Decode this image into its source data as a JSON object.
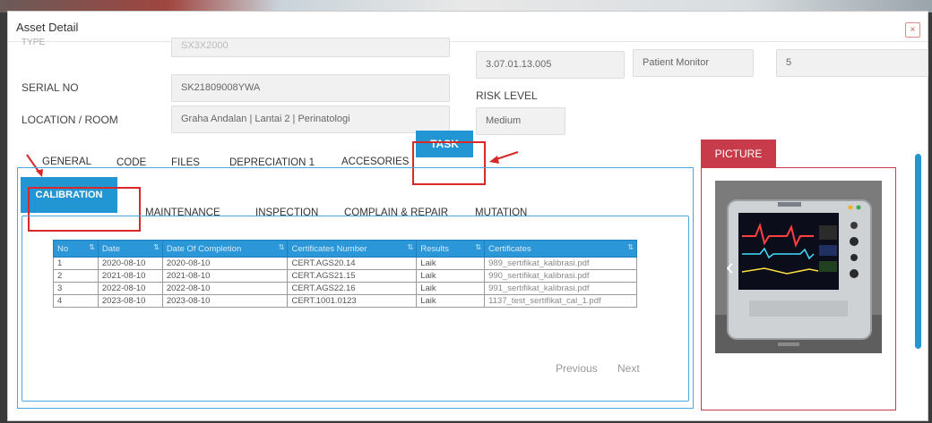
{
  "modal": {
    "title": "Asset Detail",
    "close_label": "×"
  },
  "form": {
    "type_label": "TYPE",
    "type_value": "SX3X2000",
    "serial_label": "SERIAL NO",
    "serial_value": "SK21809008YWA",
    "location_label": "LOCATION / ROOM",
    "location_value": "Graha Andalan | Lantai 2 | Perinatologi",
    "code_value": "3.07.01.13.005",
    "category_value": "Patient Monitor",
    "quantity_value": "5",
    "risk_label": "RISK LEVEL",
    "risk_value": "Medium"
  },
  "tabs": [
    "GENERAL",
    "CODE",
    "FILES",
    "DEPRECIATION 1",
    "ACCESORIES",
    "TASK"
  ],
  "subtabs": [
    "CALIBRATION",
    "MAINTENANCE",
    "INSPECTION",
    "COMPLAIN & REPAIR",
    "MUTATION"
  ],
  "table": {
    "headers": [
      "No",
      "Date",
      "Date Of Completion",
      "Certificates Number",
      "Results",
      "Certificates"
    ],
    "rows": [
      [
        "1",
        "2020-08-10",
        "2020-08-10",
        "CERT.AGS20.14",
        "Laik",
        "989_sertifikat_kalibrasi.pdf"
      ],
      [
        "2",
        "2021-08-10",
        "2021-08-10",
        "CERT.AGS21.15",
        "Laik",
        "990_sertifikat_kalibrasi.pdf"
      ],
      [
        "3",
        "2022-08-10",
        "2022-08-10",
        "CERT.AGS22.16",
        "Laik",
        "991_sertifikat_kalibrasi.pdf"
      ],
      [
        "4",
        "2023-08-10",
        "2023-08-10",
        "CERT.1001.0123",
        "Laik",
        "1137_test_sertifikat_cal_1.pdf"
      ]
    ]
  },
  "pager": {
    "previous": "Previous",
    "next": "Next"
  },
  "picture": {
    "tab_label": "PICTURE",
    "prev_icon": "‹"
  },
  "colors": {
    "accent": "#2196d3",
    "picture": "#c83b4a",
    "highlight": "#d92828"
  }
}
